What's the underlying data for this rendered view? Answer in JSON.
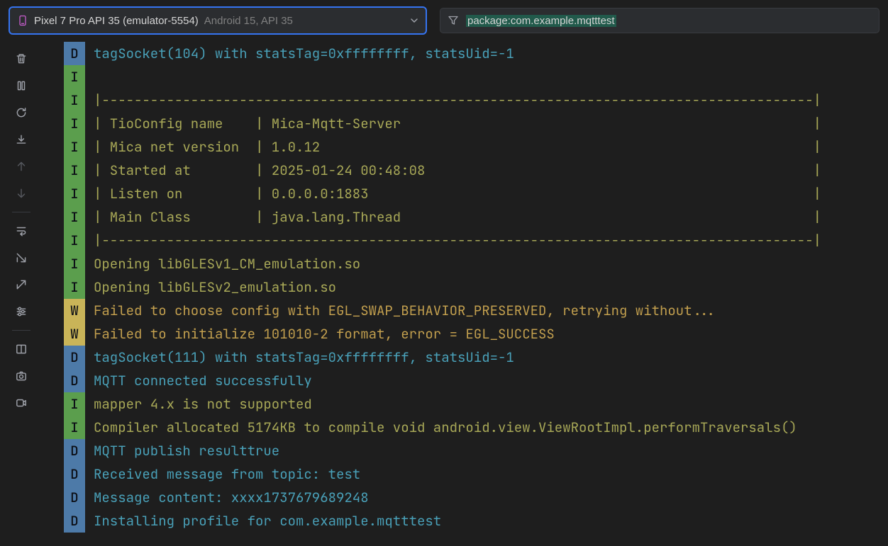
{
  "device": {
    "primary": "Pixel 7 Pro API 35 (emulator-5554)",
    "secondary": "Android 15, API 35"
  },
  "filter": {
    "value": "package:com.example.mqtttest"
  },
  "sidebar": [
    {
      "name": "trash-icon",
      "title": "Clear"
    },
    {
      "name": "pause-icon",
      "title": "Pause"
    },
    {
      "name": "restart-icon",
      "title": "Restart"
    },
    {
      "name": "scroll-end-icon",
      "title": "Scroll to end"
    },
    {
      "name": "up-arrow-icon",
      "title": "Up"
    },
    {
      "name": "down-arrow-icon",
      "title": "Down"
    },
    {
      "type": "divider"
    },
    {
      "name": "soft-wrap-icon",
      "title": "Soft wrap"
    },
    {
      "name": "import-icon",
      "title": "Import"
    },
    {
      "name": "export-icon",
      "title": "Export"
    },
    {
      "name": "settings-icon",
      "title": "Settings"
    },
    {
      "type": "divider"
    },
    {
      "name": "split-icon",
      "title": "Split"
    },
    {
      "name": "screenshot-icon",
      "title": "Screenshot"
    },
    {
      "name": "screen-record-icon",
      "title": "Record"
    }
  ],
  "log": [
    {
      "lvl": "D",
      "msg": "tagSocket(104) with statsTag=0xffffffff, statsUid=-1"
    },
    {
      "lvl": "I",
      "msg": ""
    },
    {
      "lvl": "I",
      "msg": "|----------------------------------------------------------------------------------------|"
    },
    {
      "lvl": "I",
      "msg": "| TioConfig name    | Mica-Mqtt-Server                                                   |"
    },
    {
      "lvl": "I",
      "msg": "| Mica net version  | 1.0.12                                                             |"
    },
    {
      "lvl": "I",
      "msg": "| Started at        | 2025-01-24 00:48:08                                                |"
    },
    {
      "lvl": "I",
      "msg": "| Listen on         | 0.0.0.0:1883                                                       |"
    },
    {
      "lvl": "I",
      "msg": "| Main Class        | java.lang.Thread                                                   |"
    },
    {
      "lvl": "I",
      "msg": "|----------------------------------------------------------------------------------------|"
    },
    {
      "lvl": "I",
      "msg": "Opening libGLESv1_CM_emulation.so"
    },
    {
      "lvl": "I",
      "msg": "Opening libGLESv2_emulation.so"
    },
    {
      "lvl": "W",
      "msg": "Failed to choose config with EGL_SWAP_BEHAVIOR_PRESERVED, retrying without..."
    },
    {
      "lvl": "W",
      "msg": "Failed to initialize 101010-2 format, error = EGL_SUCCESS"
    },
    {
      "lvl": "D",
      "msg": "tagSocket(111) with statsTag=0xffffffff, statsUid=-1"
    },
    {
      "lvl": "D",
      "msg": "MQTT connected successfully"
    },
    {
      "lvl": "I",
      "msg": "mapper 4.x is not supported"
    },
    {
      "lvl": "I",
      "msg": "Compiler allocated 5174KB to compile void android.view.ViewRootImpl.performTraversals()"
    },
    {
      "lvl": "D",
      "msg": "MQTT publish resulttrue"
    },
    {
      "lvl": "D",
      "msg": "Received message from topic: test"
    },
    {
      "lvl": "D",
      "msg": "Message content: xxxx1737679689248"
    },
    {
      "lvl": "D",
      "msg": "Installing profile for com.example.mqtttest"
    }
  ]
}
